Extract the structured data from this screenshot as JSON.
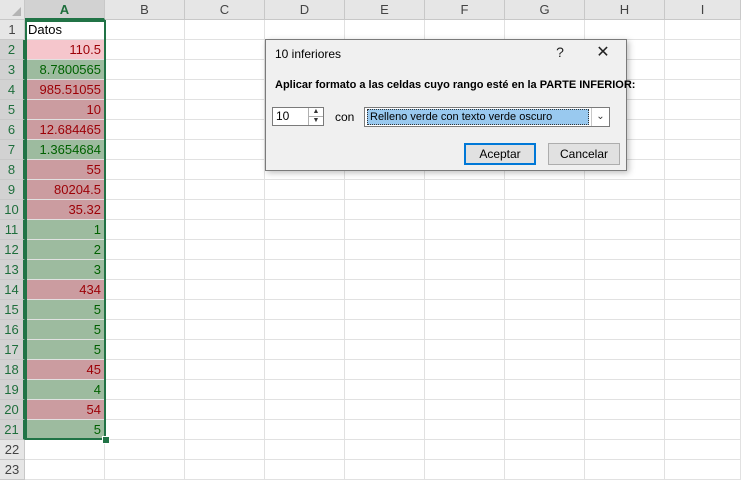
{
  "columns": [
    "A",
    "B",
    "C",
    "D",
    "E",
    "F",
    "G",
    "H",
    "I"
  ],
  "rows": [
    "1",
    "2",
    "3",
    "4",
    "5",
    "6",
    "7",
    "8",
    "9",
    "10",
    "11",
    "12",
    "13",
    "14",
    "15",
    "16",
    "17",
    "18",
    "19",
    "20",
    "21",
    "22",
    "23"
  ],
  "header_cell": "Datos",
  "cells": [
    {
      "value": "110.5",
      "fill": "lightred"
    },
    {
      "value": "8.7800565",
      "fill": "green"
    },
    {
      "value": "985.51055",
      "fill": "red"
    },
    {
      "value": "10",
      "fill": "red"
    },
    {
      "value": "12.684465",
      "fill": "red"
    },
    {
      "value": "1.3654684",
      "fill": "green"
    },
    {
      "value": "55",
      "fill": "red"
    },
    {
      "value": "80204.5",
      "fill": "red"
    },
    {
      "value": "35.32",
      "fill": "red"
    },
    {
      "value": "1",
      "fill": "green"
    },
    {
      "value": "2",
      "fill": "green"
    },
    {
      "value": "3",
      "fill": "green"
    },
    {
      "value": "434",
      "fill": "red"
    },
    {
      "value": "5",
      "fill": "green"
    },
    {
      "value": "5",
      "fill": "green"
    },
    {
      "value": "5",
      "fill": "green"
    },
    {
      "value": "45",
      "fill": "red"
    },
    {
      "value": "4",
      "fill": "green"
    },
    {
      "value": "54",
      "fill": "red"
    },
    {
      "value": "5",
      "fill": "green"
    }
  ],
  "dialog": {
    "title": "10 inferiores",
    "help": "?",
    "close": "✕",
    "prompt": "Aplicar formato a las celdas cuyo rango esté en la PARTE INFERIOR:",
    "count_value": "10",
    "con_label": "con",
    "format_selected": "Relleno verde con texto verde oscuro",
    "ok_label": "Aceptar",
    "cancel_label": "Cancelar"
  },
  "colors": {
    "accent": "#217346",
    "red_fill": "#cb9ca0",
    "green_fill": "#9dbb9f",
    "lightred_fill": "#f5c6cc"
  }
}
